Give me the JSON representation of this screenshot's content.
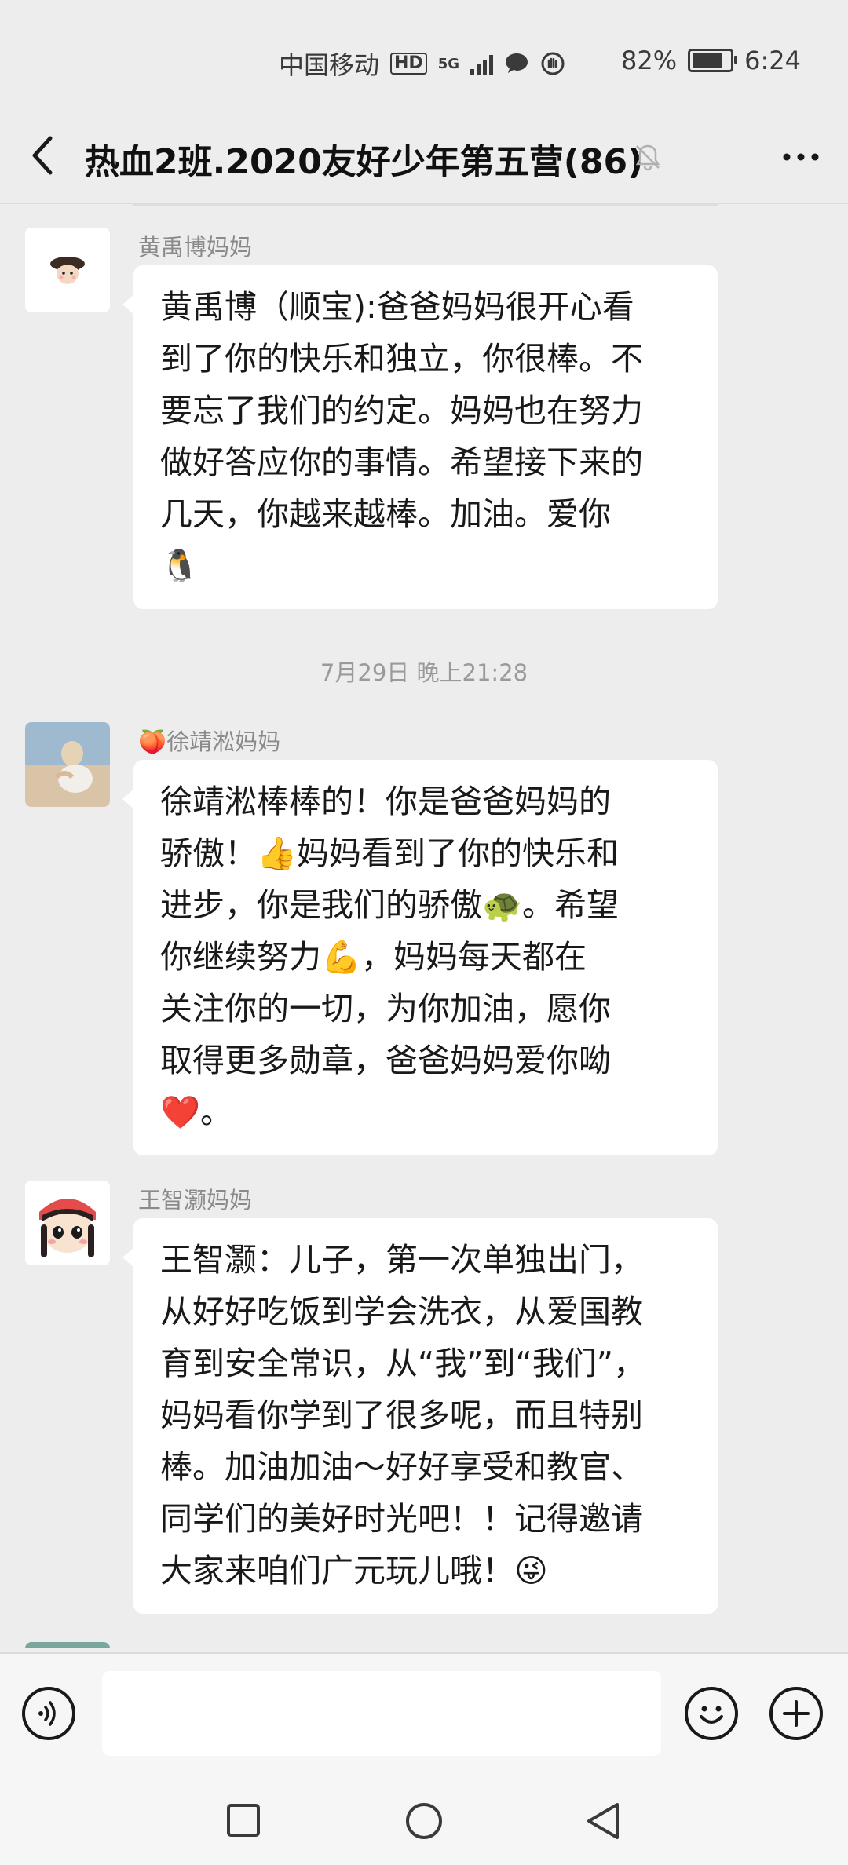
{
  "status_bar": {
    "carrier": "中国移动",
    "hd": "HD",
    "network": "5G",
    "battery_percent": "82%",
    "battery_level": 0.82,
    "time": "6:24"
  },
  "nav": {
    "title": "热血2班.2020友好少年第五营(86)",
    "icons": [
      "back-icon",
      "mute-bell-icon",
      "more-icon"
    ]
  },
  "messages": [
    {
      "sender": "黄禹博妈妈",
      "lines": [
        "黄禹博（顺宝):爸爸妈妈很开心看",
        "到了你的快乐和独立，你很棒。不",
        "要忘了我们的约定。妈妈也在努力",
        "做好答应你的事情。希望接下来的",
        "几天，你越来越棒。加油。爱你",
        "🐧"
      ]
    },
    {
      "timestamp": "7月29日 晚上21:28"
    },
    {
      "sender": "🍑徐靖淞妈妈",
      "lines": [
        "徐靖淞棒棒的！你是爸爸妈妈的",
        "骄傲！👍妈妈看到了你的快乐和",
        "进步，你是我们的骄傲🐢。希望",
        "你继续努力💪，妈妈每天都在",
        "关注你的一切，为你加油，愿你",
        "取得更多勋章，爸爸妈妈爱你呦",
        "❤️。"
      ]
    },
    {
      "sender": "王智灏妈妈",
      "lines": [
        "王智灏：儿子，第一次单独出门，",
        "从好好吃饭到学会洗衣，从爱国教",
        "育到安全常识，从“我”到“我们”，",
        "妈妈看你学到了很多呢，而且特别",
        "棒。加油加油～好好享受和教官、",
        "同学们的美好时光吧！！记得邀请",
        "大家来咱们广元玩儿哦！😜"
      ]
    }
  ],
  "input_bar": {
    "icons": [
      "voice-icon",
      "emoji-icon",
      "plus-icon"
    ]
  },
  "system_nav": {
    "icons": [
      "recents-icon",
      "home-icon",
      "back-triangle-icon"
    ]
  }
}
